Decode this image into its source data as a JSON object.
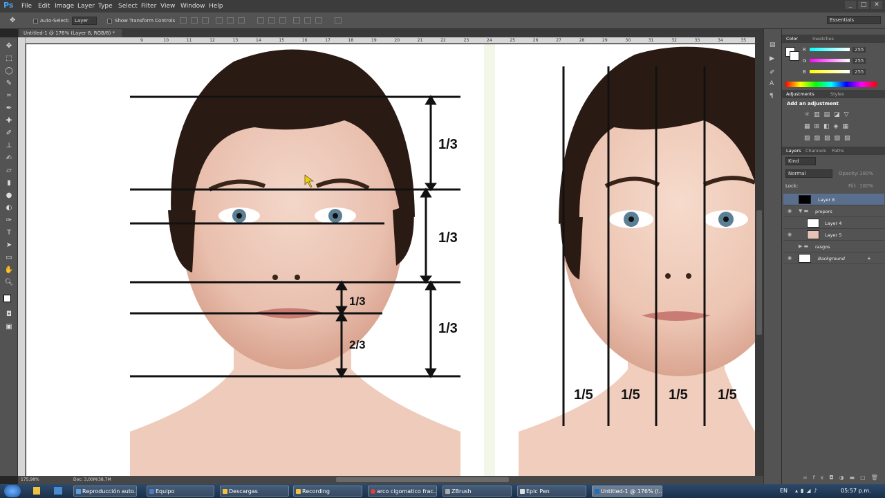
{
  "app": {
    "logo": "Ps",
    "workspace": "Essentials"
  },
  "menu": [
    "File",
    "Edit",
    "Image",
    "Layer",
    "Type",
    "Select",
    "Filter",
    "View",
    "Window",
    "Help"
  ],
  "window_controls": [
    "_",
    "□",
    "✕"
  ],
  "options": {
    "auto_select_label": "Auto-Select:",
    "auto_select_value": "Layer",
    "transform_label": "Show Transform Controls"
  },
  "doc_tab": {
    "title": "Untitled-1 @ 176% (Layer 8, RGB/8) *",
    "close": "×"
  },
  "ruler_ticks": [
    "9",
    "10",
    "11",
    "12",
    "13",
    "14",
    "15",
    "16",
    "17",
    "18",
    "19",
    "20",
    "21",
    "22",
    "23",
    "24",
    "25",
    "26",
    "27",
    "28",
    "29",
    "30",
    "31",
    "32",
    "33",
    "34",
    "35"
  ],
  "status": {
    "zoom": "175,98%",
    "doc": "Doc: 3,00M/38,7M"
  },
  "canvas": {
    "left_ratios": [
      "1/3",
      "1/3",
      "1/3",
      "1/3",
      "2/3"
    ],
    "right_ratios": [
      "1/5",
      "1/5",
      "1/5",
      "1/5"
    ]
  },
  "color_panel": {
    "tabs": [
      "Color",
      "Swatches"
    ],
    "channels": [
      {
        "name": "R",
        "value": "255"
      },
      {
        "name": "G",
        "value": "255"
      },
      {
        "name": "B",
        "value": "255"
      }
    ]
  },
  "adjustments_panel": {
    "tabs": [
      "Adjustments",
      "Styles"
    ],
    "title": "Add an adjustment"
  },
  "layers_panel": {
    "tabs": [
      "Layers",
      "Channels",
      "Paths"
    ],
    "kind": "Kind",
    "blend": "Normal",
    "opacity_label": "Opacity:",
    "opacity_value": "100%",
    "lock_label": "Lock:",
    "fill_label": "Fill:",
    "fill_value": "100%",
    "layers": [
      {
        "name": "Layer 8",
        "selected": true,
        "visible": false
      },
      {
        "name": "propors",
        "group": true,
        "open": true,
        "visible": true
      },
      {
        "name": "Layer 4",
        "visible": false
      },
      {
        "name": "Layer 5",
        "visible": true
      },
      {
        "name": "rasgos",
        "group": true,
        "open": false,
        "visible": false
      },
      {
        "name": "Background",
        "visible": true,
        "locked": true
      }
    ]
  },
  "taskbar": {
    "tasks": [
      "Reproducción auto...",
      "Equipo",
      "Descargas",
      "Recording",
      "arco cigomatico frac...",
      "ZBrush",
      "Epic Pen",
      "Untitled-1 @ 176% (l..."
    ],
    "lang": "EN",
    "time": "05:57 p.m."
  }
}
